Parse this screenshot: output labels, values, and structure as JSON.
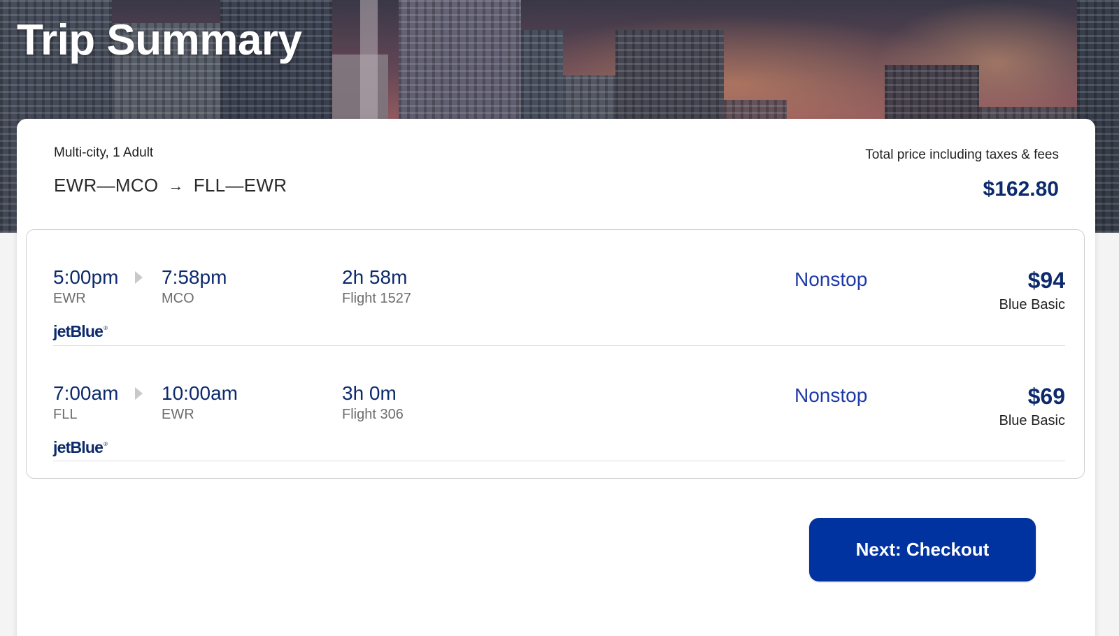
{
  "page": {
    "title": "Trip Summary"
  },
  "summary": {
    "trip_type": "Multi-city, 1 Adult",
    "route_leg1": "EWR—MCO",
    "route_arrow": "→",
    "route_leg2": "FLL—EWR",
    "total_label": "Total price including taxes & fees",
    "total_price": "$162.80"
  },
  "flights": [
    {
      "depart_time": "5:00pm",
      "depart_airport": "EWR",
      "arrive_time": "7:58pm",
      "arrive_airport": "MCO",
      "duration": "2h 58m",
      "flight_number": "Flight 1527",
      "airline": "jetBlue",
      "stops": "Nonstop",
      "price": "$94",
      "fare_type": "Blue Basic"
    },
    {
      "depart_time": "7:00am",
      "depart_airport": "FLL",
      "arrive_time": "10:00am",
      "arrive_airport": "EWR",
      "duration": "3h 0m",
      "flight_number": "Flight 306",
      "airline": "jetBlue",
      "stops": "Nonstop",
      "price": "$69",
      "fare_type": "Blue Basic"
    }
  ],
  "actions": {
    "checkout_label": "Next: Checkout"
  },
  "colors": {
    "brand_navy": "#0c2a6c",
    "stops_blue": "#1e3aa8",
    "button_blue": "#0033a0"
  },
  "icons": {
    "route_arrow": "arrow-right-icon",
    "segment_separator": "play-triangle-icon"
  }
}
